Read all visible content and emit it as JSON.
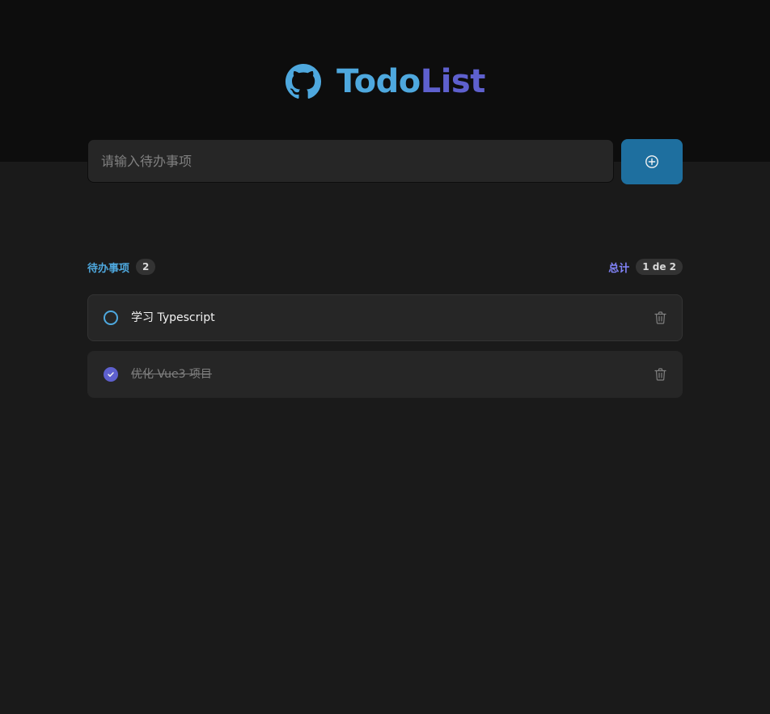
{
  "brand": {
    "logo_icon": "github-icon",
    "title_part_1": "Todo",
    "title_part_2": "List",
    "colors": {
      "blue": "#4ea8de",
      "purple": "#5e60ce",
      "button": "#1e6f9f"
    }
  },
  "new_task": {
    "placeholder": "请输入待办事项",
    "value": "",
    "add_icon": "plus-circle-icon"
  },
  "summary": {
    "created_label": "待办事项",
    "created_count": "2",
    "completed_label": "总计",
    "completed_count": "1 de 2"
  },
  "tasks": [
    {
      "text": "学习 Typescript",
      "completed": false,
      "delete_icon": "trash-icon"
    },
    {
      "text": "优化 Vue3 项目",
      "completed": true,
      "delete_icon": "trash-icon"
    }
  ]
}
